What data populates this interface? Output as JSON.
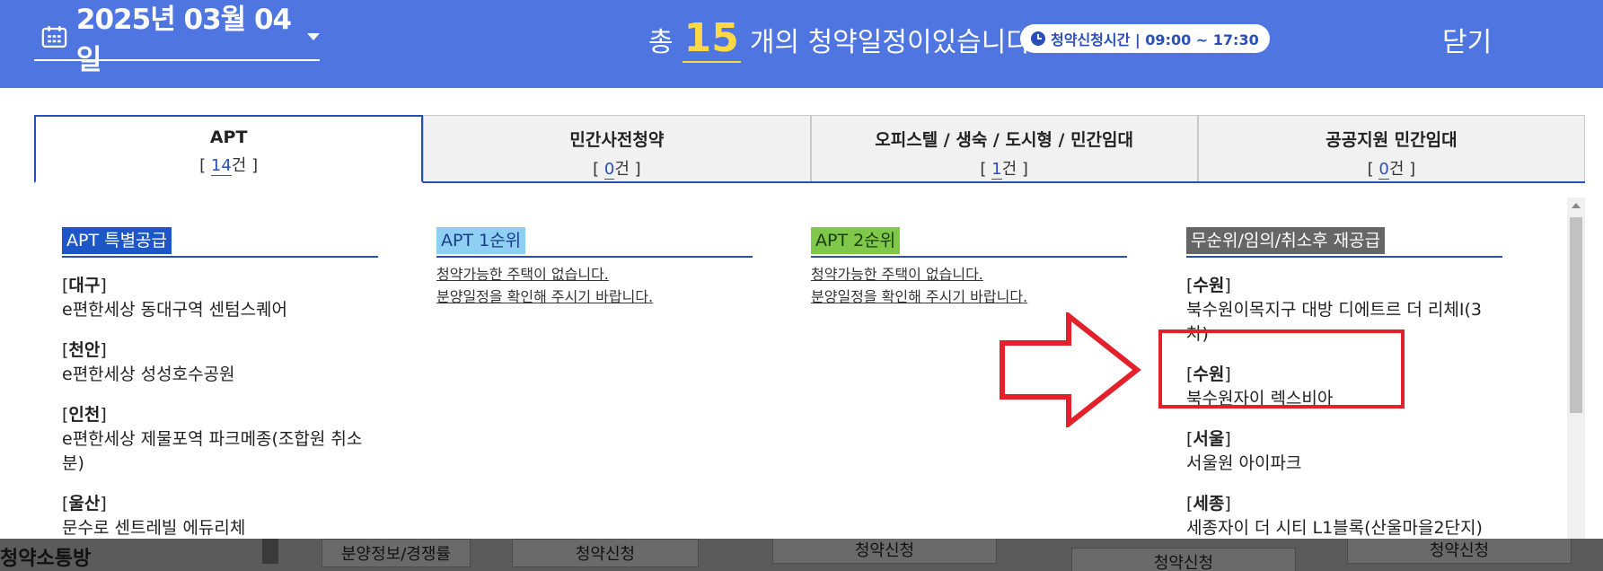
{
  "header": {
    "date": "2025년 03월 04일",
    "summary_pre": "총",
    "total_count": "15",
    "summary_post": "개의 청약일정이있습니다.",
    "time_badge": "청약신청시간 | 09:00 ~ 17:30",
    "close_label": "닫기"
  },
  "tabs": [
    {
      "name": "APT",
      "open": "[ ",
      "count": "14",
      "unit": "건 ]",
      "active": true
    },
    {
      "name": "민간사전청약",
      "open": "[ ",
      "count": "0",
      "unit": "건 ]",
      "active": false
    },
    {
      "name": "오피스텔 / 생숙 / 도시형 / 민간임대",
      "open": "[ ",
      "count": "1",
      "unit": "건 ]",
      "active": false
    },
    {
      "name": "공공지원 민간임대",
      "open": "[ ",
      "count": "0",
      "unit": "건 ]",
      "active": false
    }
  ],
  "columns": {
    "special": {
      "title": "APT 특별공급",
      "entries": [
        {
          "region": "대구",
          "name": "e편한세상 동대구역 센텀스퀘어"
        },
        {
          "region": "천안",
          "name": "e편한세상 성성호수공원"
        },
        {
          "region": "인천",
          "name": "e편한세상 제물포역 파크메종(조합원 취소분)"
        },
        {
          "region": "울산",
          "name": "문수로 센트레빌 에듀리체"
        }
      ]
    },
    "first": {
      "title": "APT 1순위",
      "empty_line1": "청약가능한 주택이 없습니다.",
      "empty_line2": "분양일정을 확인해 주시기 바랍니다."
    },
    "second": {
      "title": "APT 2순위",
      "empty_line1": "청약가능한 주택이 없습니다.",
      "empty_line2": "분양일정을 확인해 주시기 바랍니다."
    },
    "rest": {
      "title": "무순위/임의/취소후 재공급",
      "entries": [
        {
          "region": "수원",
          "name": "북수원이목지구 대방 디에트르 더 리체Ⅰ(3차)"
        },
        {
          "region": "수원",
          "name": "북수원자이 렉스비아"
        },
        {
          "region": "서울",
          "name": "서울원 아이파크"
        },
        {
          "region": "세종",
          "name": "세종자이 더 시티 L1블록(산울마을2단지)"
        }
      ]
    }
  },
  "background": {
    "title": "청약소통방",
    "btn_info": "분양정보/경쟁률",
    "btn_apply1": "청약신청",
    "btn_apply2": "청약신청",
    "btn_apply3": "청약신청",
    "btn_apply4": "청약신청"
  },
  "colors": {
    "header_bg": "#4f75e0",
    "accent_blue": "#2a4fb6",
    "count_yellow": "#ffd84a",
    "highlight_red": "#e3212b"
  }
}
